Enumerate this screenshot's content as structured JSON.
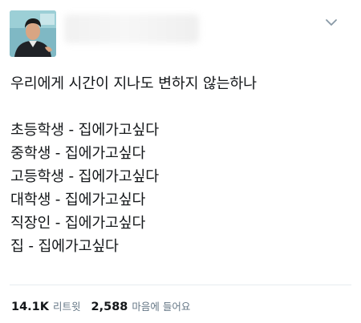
{
  "tweet": {
    "lines": [
      "우리에게 시간이 지나도 변하지 않는하나",
      "",
      "초등학생 - 집에가고싶다",
      "중학생 - 집에가고싶다",
      "고등학생 - 집에가고싶다",
      "대학생 - 집에가고싶다",
      "직장인 - 집에가고싶다",
      "집 - 집에가고싶다"
    ]
  },
  "stats": {
    "retweets_count": "14.1K",
    "retweets_label": "리트윗",
    "likes_count": "2,588",
    "likes_label": "마음에 들어요"
  },
  "icons": {
    "menu": "chevron-down-icon"
  },
  "colors": {
    "text": "#14171a",
    "secondary_text": "#657786",
    "divider": "#e6ecf0"
  }
}
